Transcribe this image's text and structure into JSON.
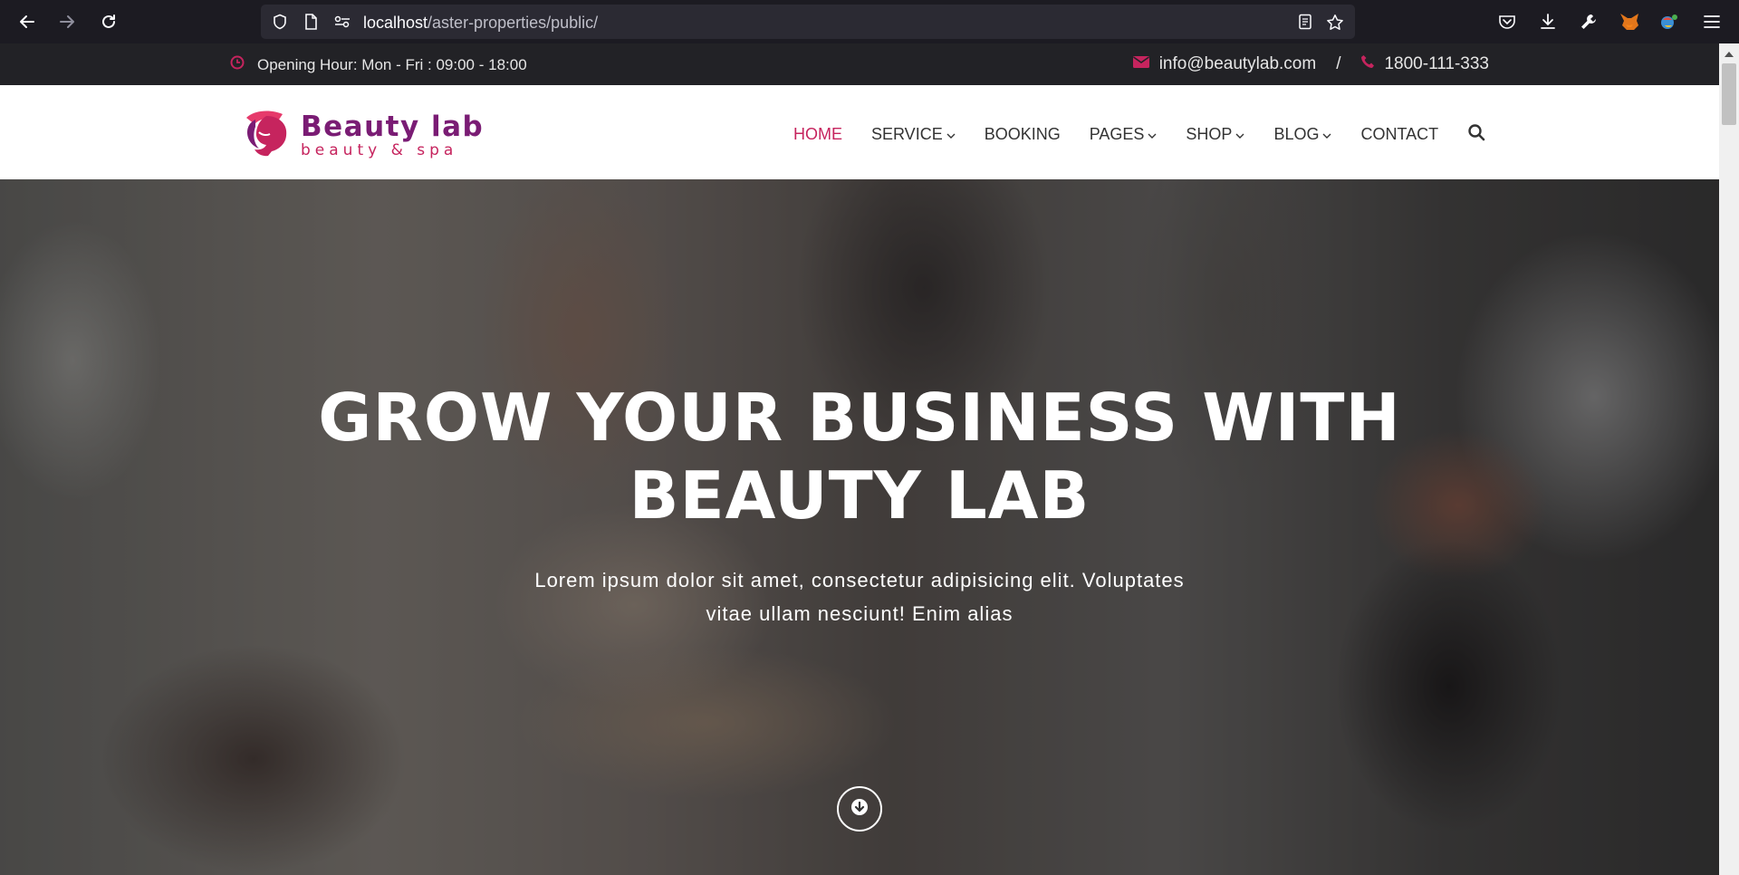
{
  "browser": {
    "url_host": "localhost",
    "url_path": "/aster-properties/public/",
    "icons": [
      "back-arrow-icon",
      "forward-arrow-icon",
      "reload-icon",
      "shield-icon",
      "page-icon",
      "permissions-icon",
      "reader-mode-icon",
      "bookmark-star-icon",
      "pocket-icon",
      "download-icon",
      "wrench-icon",
      "metamask-fox-icon",
      "extension-icon",
      "hamburger-menu-icon"
    ]
  },
  "topbar": {
    "hours": "Opening Hour: Mon - Fri : 09:00 - 18:00",
    "email": "info@beautylab.com",
    "separator": "/",
    "phone": "1800-111-333"
  },
  "header": {
    "logo_title": "Beauty lab",
    "logo_subtitle": "beauty & spa",
    "menu": [
      {
        "label": "HOME",
        "active": true,
        "dropdown": false
      },
      {
        "label": "SERVICE",
        "active": false,
        "dropdown": true
      },
      {
        "label": "BOOKING",
        "active": false,
        "dropdown": false
      },
      {
        "label": "PAGES",
        "active": false,
        "dropdown": true
      },
      {
        "label": "SHOP",
        "active": false,
        "dropdown": true
      },
      {
        "label": "BLOG",
        "active": false,
        "dropdown": true
      },
      {
        "label": "CONTACT",
        "active": false,
        "dropdown": false
      }
    ]
  },
  "hero": {
    "title_line1": "GROW YOUR BUSINESS WITH",
    "title_line2": "BEAUTY LAB",
    "subtitle_line1": "Lorem ipsum dolor sit amet, consectetur adipisicing elit. Voluptates",
    "subtitle_line2": "vitae ullam nesciunt! Enim alias"
  },
  "colors": {
    "accent": "#c6245e",
    "brand": "#7a1c74",
    "topbar_bg": "#222226"
  }
}
